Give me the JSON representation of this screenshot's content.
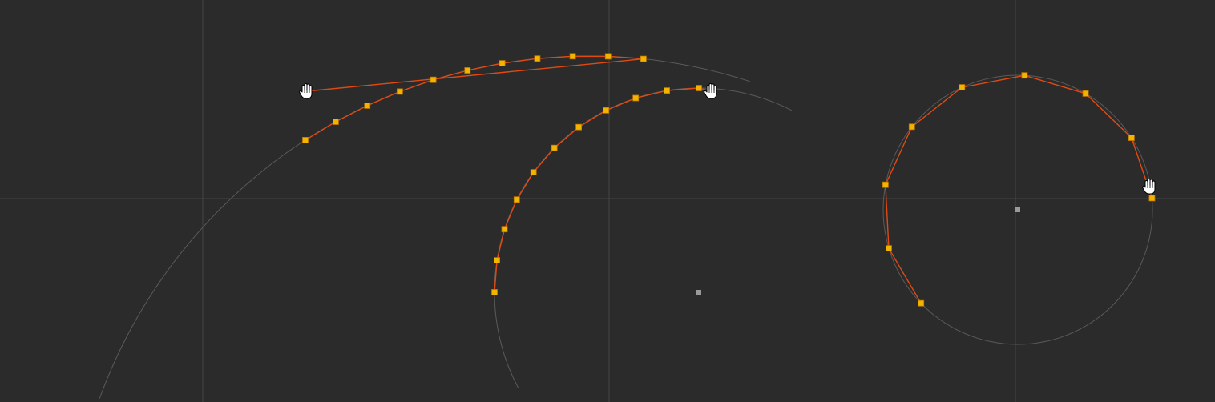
{
  "colors": {
    "background": "#2b2b2b",
    "axis": "#454545",
    "guide": "#5a5a5a",
    "polyline": "#e04a12",
    "vertex_fill": "#f3b400",
    "vertex_stroke": "#c07a00",
    "center_marker": "#9a9a9a",
    "cursor": "#ffffff"
  },
  "icons": {
    "cursor": "grab-hand-cursor-icon",
    "vertex": "arc-vertex-handle-icon",
    "center": "arc-center-marker-icon"
  },
  "panels": [
    {
      "name": "arc-panel-1",
      "segments": 10,
      "cursor": "grab-hand-cursor-icon"
    },
    {
      "name": "arc-panel-2",
      "segments": 10,
      "cursor": "grab-hand-cursor-icon"
    },
    {
      "name": "arc-panel-3",
      "segments": 8,
      "cursor": "grab-hand-cursor-icon"
    }
  ]
}
